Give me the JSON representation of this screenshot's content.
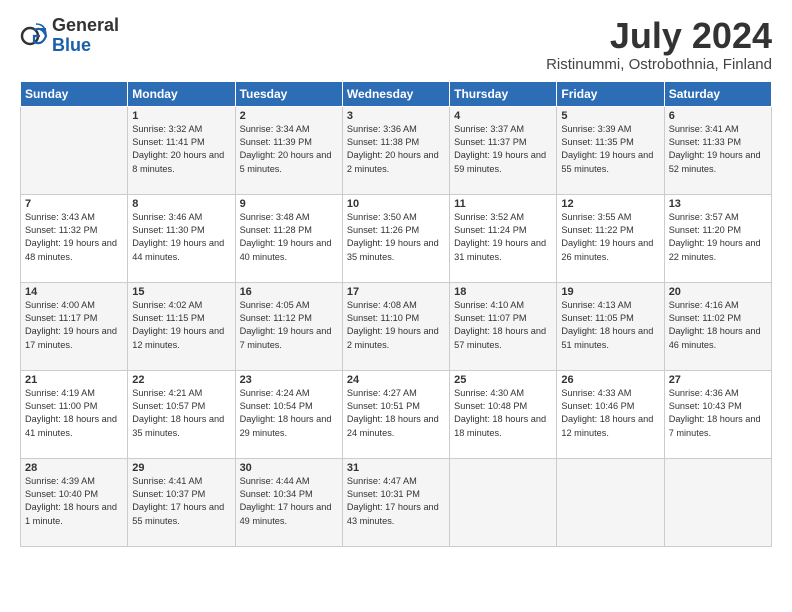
{
  "header": {
    "logo_general": "General",
    "logo_blue": "Blue",
    "title": "July 2024",
    "location": "Ristinummi, Ostrobothnia, Finland"
  },
  "days_header": [
    "Sunday",
    "Monday",
    "Tuesday",
    "Wednesday",
    "Thursday",
    "Friday",
    "Saturday"
  ],
  "weeks": [
    [
      {
        "num": "",
        "sunrise": "",
        "sunset": "",
        "daylight": ""
      },
      {
        "num": "1",
        "sunrise": "Sunrise: 3:32 AM",
        "sunset": "Sunset: 11:41 PM",
        "daylight": "Daylight: 20 hours and 8 minutes."
      },
      {
        "num": "2",
        "sunrise": "Sunrise: 3:34 AM",
        "sunset": "Sunset: 11:39 PM",
        "daylight": "Daylight: 20 hours and 5 minutes."
      },
      {
        "num": "3",
        "sunrise": "Sunrise: 3:36 AM",
        "sunset": "Sunset: 11:38 PM",
        "daylight": "Daylight: 20 hours and 2 minutes."
      },
      {
        "num": "4",
        "sunrise": "Sunrise: 3:37 AM",
        "sunset": "Sunset: 11:37 PM",
        "daylight": "Daylight: 19 hours and 59 minutes."
      },
      {
        "num": "5",
        "sunrise": "Sunrise: 3:39 AM",
        "sunset": "Sunset: 11:35 PM",
        "daylight": "Daylight: 19 hours and 55 minutes."
      },
      {
        "num": "6",
        "sunrise": "Sunrise: 3:41 AM",
        "sunset": "Sunset: 11:33 PM",
        "daylight": "Daylight: 19 hours and 52 minutes."
      }
    ],
    [
      {
        "num": "7",
        "sunrise": "Sunrise: 3:43 AM",
        "sunset": "Sunset: 11:32 PM",
        "daylight": "Daylight: 19 hours and 48 minutes."
      },
      {
        "num": "8",
        "sunrise": "Sunrise: 3:46 AM",
        "sunset": "Sunset: 11:30 PM",
        "daylight": "Daylight: 19 hours and 44 minutes."
      },
      {
        "num": "9",
        "sunrise": "Sunrise: 3:48 AM",
        "sunset": "Sunset: 11:28 PM",
        "daylight": "Daylight: 19 hours and 40 minutes."
      },
      {
        "num": "10",
        "sunrise": "Sunrise: 3:50 AM",
        "sunset": "Sunset: 11:26 PM",
        "daylight": "Daylight: 19 hours and 35 minutes."
      },
      {
        "num": "11",
        "sunrise": "Sunrise: 3:52 AM",
        "sunset": "Sunset: 11:24 PM",
        "daylight": "Daylight: 19 hours and 31 minutes."
      },
      {
        "num": "12",
        "sunrise": "Sunrise: 3:55 AM",
        "sunset": "Sunset: 11:22 PM",
        "daylight": "Daylight: 19 hours and 26 minutes."
      },
      {
        "num": "13",
        "sunrise": "Sunrise: 3:57 AM",
        "sunset": "Sunset: 11:20 PM",
        "daylight": "Daylight: 19 hours and 22 minutes."
      }
    ],
    [
      {
        "num": "14",
        "sunrise": "Sunrise: 4:00 AM",
        "sunset": "Sunset: 11:17 PM",
        "daylight": "Daylight: 19 hours and 17 minutes."
      },
      {
        "num": "15",
        "sunrise": "Sunrise: 4:02 AM",
        "sunset": "Sunset: 11:15 PM",
        "daylight": "Daylight: 19 hours and 12 minutes."
      },
      {
        "num": "16",
        "sunrise": "Sunrise: 4:05 AM",
        "sunset": "Sunset: 11:12 PM",
        "daylight": "Daylight: 19 hours and 7 minutes."
      },
      {
        "num": "17",
        "sunrise": "Sunrise: 4:08 AM",
        "sunset": "Sunset: 11:10 PM",
        "daylight": "Daylight: 19 hours and 2 minutes."
      },
      {
        "num": "18",
        "sunrise": "Sunrise: 4:10 AM",
        "sunset": "Sunset: 11:07 PM",
        "daylight": "Daylight: 18 hours and 57 minutes."
      },
      {
        "num": "19",
        "sunrise": "Sunrise: 4:13 AM",
        "sunset": "Sunset: 11:05 PM",
        "daylight": "Daylight: 18 hours and 51 minutes."
      },
      {
        "num": "20",
        "sunrise": "Sunrise: 4:16 AM",
        "sunset": "Sunset: 11:02 PM",
        "daylight": "Daylight: 18 hours and 46 minutes."
      }
    ],
    [
      {
        "num": "21",
        "sunrise": "Sunrise: 4:19 AM",
        "sunset": "Sunset: 11:00 PM",
        "daylight": "Daylight: 18 hours and 41 minutes."
      },
      {
        "num": "22",
        "sunrise": "Sunrise: 4:21 AM",
        "sunset": "Sunset: 10:57 PM",
        "daylight": "Daylight: 18 hours and 35 minutes."
      },
      {
        "num": "23",
        "sunrise": "Sunrise: 4:24 AM",
        "sunset": "Sunset: 10:54 PM",
        "daylight": "Daylight: 18 hours and 29 minutes."
      },
      {
        "num": "24",
        "sunrise": "Sunrise: 4:27 AM",
        "sunset": "Sunset: 10:51 PM",
        "daylight": "Daylight: 18 hours and 24 minutes."
      },
      {
        "num": "25",
        "sunrise": "Sunrise: 4:30 AM",
        "sunset": "Sunset: 10:48 PM",
        "daylight": "Daylight: 18 hours and 18 minutes."
      },
      {
        "num": "26",
        "sunrise": "Sunrise: 4:33 AM",
        "sunset": "Sunset: 10:46 PM",
        "daylight": "Daylight: 18 hours and 12 minutes."
      },
      {
        "num": "27",
        "sunrise": "Sunrise: 4:36 AM",
        "sunset": "Sunset: 10:43 PM",
        "daylight": "Daylight: 18 hours and 7 minutes."
      }
    ],
    [
      {
        "num": "28",
        "sunrise": "Sunrise: 4:39 AM",
        "sunset": "Sunset: 10:40 PM",
        "daylight": "Daylight: 18 hours and 1 minute."
      },
      {
        "num": "29",
        "sunrise": "Sunrise: 4:41 AM",
        "sunset": "Sunset: 10:37 PM",
        "daylight": "Daylight: 17 hours and 55 minutes."
      },
      {
        "num": "30",
        "sunrise": "Sunrise: 4:44 AM",
        "sunset": "Sunset: 10:34 PM",
        "daylight": "Daylight: 17 hours and 49 minutes."
      },
      {
        "num": "31",
        "sunrise": "Sunrise: 4:47 AM",
        "sunset": "Sunset: 10:31 PM",
        "daylight": "Daylight: 17 hours and 43 minutes."
      },
      {
        "num": "",
        "sunrise": "",
        "sunset": "",
        "daylight": ""
      },
      {
        "num": "",
        "sunrise": "",
        "sunset": "",
        "daylight": ""
      },
      {
        "num": "",
        "sunrise": "",
        "sunset": "",
        "daylight": ""
      }
    ]
  ]
}
